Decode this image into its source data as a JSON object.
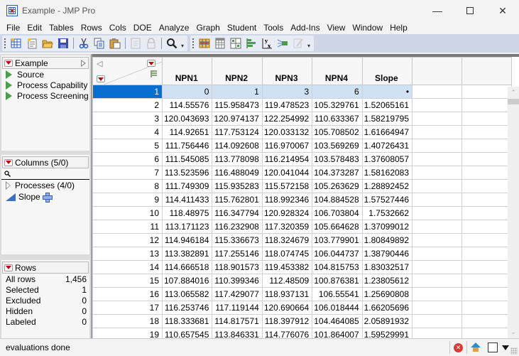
{
  "window": {
    "title": "Example - JMP Pro",
    "controls": [
      "minimize",
      "maximize",
      "close"
    ]
  },
  "menubar": [
    "File",
    "Edit",
    "Tables",
    "Rows",
    "Cols",
    "DOE",
    "Analyze",
    "Graph",
    "Student",
    "Tools",
    "Add-Ins",
    "View",
    "Window",
    "Help"
  ],
  "toolbar": {
    "group1": [
      "new-data-table-icon",
      "new-script-icon",
      "open-icon",
      "save-icon",
      "cut-icon",
      "copy-icon",
      "paste-icon",
      "link-disabled-icon",
      "lock-disabled-icon",
      "search-icon"
    ],
    "group2": [
      "data-table-icon",
      "column-info-icon",
      "tile-windows-icon",
      "distribution-icon",
      "fit-y-by-x-icon",
      "fit-model-icon",
      "edit-disabled-icon"
    ]
  },
  "table_panel": {
    "title": "Example",
    "scripts": [
      "Source",
      "Process Capability",
      "Process Screening"
    ]
  },
  "columns_panel": {
    "title": "Columns (5/0)",
    "search_placeholder": "",
    "items": [
      {
        "label": "Processes (4/0)",
        "type": "group"
      },
      {
        "label": "Slope",
        "type": "continuous"
      }
    ]
  },
  "rows_panel": {
    "title": "Rows",
    "stats": [
      {
        "label": "All rows",
        "value": "1,456"
      },
      {
        "label": "Selected",
        "value": "1"
      },
      {
        "label": "Excluded",
        "value": "0"
      },
      {
        "label": "Hidden",
        "value": "0"
      },
      {
        "label": "Labeled",
        "value": "0"
      }
    ]
  },
  "grid": {
    "columns": [
      "NPN1",
      "NPN2",
      "NPN3",
      "NPN4",
      "Slope"
    ],
    "selected_row": 1,
    "rows": [
      [
        "1",
        "0",
        "1",
        "3",
        "6",
        "•"
      ],
      [
        "2",
        "114.55576",
        "115.958473",
        "119.478523",
        "105.329761",
        "1.52065161"
      ],
      [
        "3",
        "120.043693",
        "120.974137",
        "122.254992",
        "110.633367",
        "1.58219795"
      ],
      [
        "4",
        "114.92651",
        "117.753124",
        "120.033132",
        "105.708502",
        "1.61664947"
      ],
      [
        "5",
        "111.756446",
        "114.092608",
        "116.970067",
        "103.569269",
        "1.40726431"
      ],
      [
        "6",
        "111.545085",
        "113.778098",
        "116.214954",
        "103.578483",
        "1.37608057"
      ],
      [
        "7",
        "113.523596",
        "116.488049",
        "120.041044",
        "104.373287",
        "1.58162083"
      ],
      [
        "8",
        "111.749309",
        "115.935283",
        "115.572158",
        "105.263629",
        "1.28892452"
      ],
      [
        "9",
        "114.411433",
        "115.762801",
        "118.992346",
        "104.884528",
        "1.57527446"
      ],
      [
        "10",
        "118.48975",
        "116.347794",
        "120.928324",
        "106.703804",
        "1.7532662"
      ],
      [
        "11",
        "113.171123",
        "116.232908",
        "117.320359",
        "105.664628",
        "1.37099012"
      ],
      [
        "12",
        "114.946184",
        "115.336673",
        "118.324679",
        "103.779901",
        "1.80849892"
      ],
      [
        "13",
        "113.382891",
        "117.255146",
        "118.074745",
        "106.044737",
        "1.38790446"
      ],
      [
        "14",
        "114.666518",
        "118.901573",
        "119.453382",
        "104.815753",
        "1.83032517"
      ],
      [
        "15",
        "107.884016",
        "110.399346",
        "112.48509",
        "100.876381",
        "1.23805612"
      ],
      [
        "16",
        "113.065582",
        "117.429077",
        "118.937131",
        "106.55541",
        "1.25690808"
      ],
      [
        "17",
        "116.253746",
        "117.119144",
        "120.690664",
        "106.018444",
        "1.66205696"
      ],
      [
        "18",
        "118.333681",
        "114.817571",
        "118.397912",
        "104.464085",
        "2.05891932"
      ],
      [
        "19",
        "110.657545",
        "113.846331",
        "114.776076",
        "101.864007",
        "1.59529991"
      ]
    ]
  },
  "status": {
    "message": "evaluations done"
  },
  "colors": {
    "selected_row_header": "#0a6ed1",
    "selected_row_cells": "#cfe1f3",
    "toolbar_bg": "#cfd6e6",
    "red_triangle": "#c80000",
    "script_green": "#4b9c4b"
  }
}
